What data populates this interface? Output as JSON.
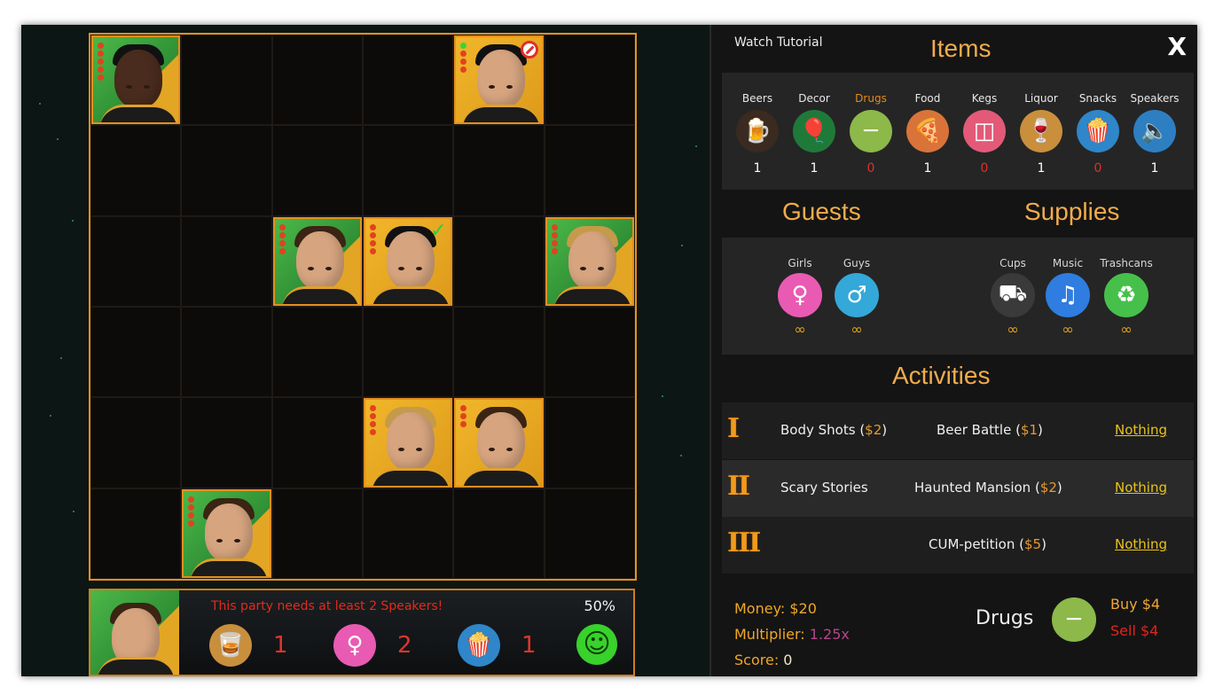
{
  "bottom_bar": {
    "warning": "This party needs at least 2 Speakers!",
    "percent": "50%",
    "needs": [
      {
        "icon": "liquor-icon",
        "count": "1"
      },
      {
        "icon": "female-symbol-icon",
        "count": "2"
      },
      {
        "icon": "snacks-icon",
        "count": "1"
      }
    ],
    "mood_icon": "smiley-face-icon"
  },
  "panel": {
    "watch_tutorial": "Watch Tutorial",
    "close": "X",
    "items_title": "Items",
    "items": [
      {
        "label": "Beers",
        "qty": "1",
        "color": "#3a2a20",
        "icon": "beer-mug-icon"
      },
      {
        "label": "Decor",
        "qty": "1",
        "color": "#1f7a3a",
        "icon": "balloons-icon"
      },
      {
        "label": "Drugs",
        "qty": "0",
        "color": "#8db84a",
        "icon": "joint-icon",
        "selected": true
      },
      {
        "label": "Food",
        "qty": "1",
        "color": "#d9733a",
        "icon": "pizza-icon"
      },
      {
        "label": "Kegs",
        "qty": "0",
        "color": "#e35a78",
        "icon": "keg-icon"
      },
      {
        "label": "Liquor",
        "qty": "1",
        "color": "#c98f3c",
        "icon": "liquor-bottles-icon"
      },
      {
        "label": "Snacks",
        "qty": "0",
        "color": "#2f86c9",
        "icon": "snack-box-icon"
      },
      {
        "label": "Speakers",
        "qty": "1",
        "color": "#2d7fc2",
        "icon": "speaker-icon"
      }
    ],
    "guests_title": "Guests",
    "supplies_title": "Supplies",
    "guests": [
      {
        "label": "Girls",
        "qty": "∞",
        "color": "#e95ab3",
        "icon": "female-symbol-icon"
      },
      {
        "label": "Guys",
        "qty": "∞",
        "color": "#34a8d8",
        "icon": "male-symbol-icon"
      }
    ],
    "supplies": [
      {
        "label": "Cups",
        "qty": "∞",
        "color": "#3a3a3a",
        "icon": "red-cup-icon"
      },
      {
        "label": "Music",
        "qty": "∞",
        "color": "#2f7de0",
        "icon": "music-note-icon"
      },
      {
        "label": "Trashcans",
        "qty": "∞",
        "color": "#46c04a",
        "icon": "recycle-icon"
      }
    ],
    "activities_title": "Activities",
    "activities": [
      {
        "tier": "I",
        "first": "Body Shots",
        "first_price": "$2",
        "second": "Beer Battle",
        "second_price": "$1",
        "choice": "Nothing"
      },
      {
        "tier": "II",
        "first": "Scary Stories",
        "first_price": "",
        "second": "Haunted Mansion",
        "second_price": "$2",
        "choice": "Nothing"
      },
      {
        "tier": "III",
        "first": "",
        "first_price": "",
        "second": "CUM-petition",
        "second_price": "$5",
        "choice": "Nothing"
      }
    ],
    "stats": {
      "money_label": "Money:",
      "money": "$20",
      "multiplier_label": "Multiplier:",
      "multiplier": "1.25x",
      "score_label": "Score:",
      "score": "0"
    },
    "selected_item": "Drugs",
    "buy_label": "Buy",
    "buy_price": "$4",
    "sell_label": "Sell",
    "sell_price": "$4"
  }
}
